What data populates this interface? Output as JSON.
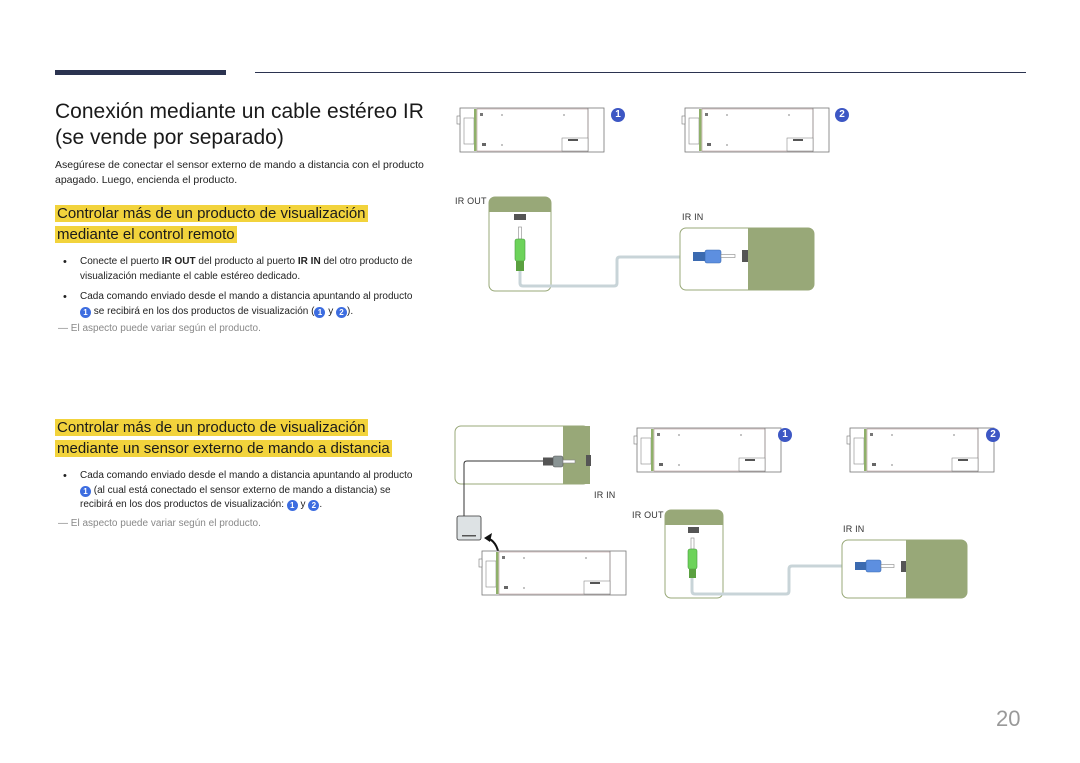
{
  "page": {
    "title": "Conexión mediante un cable estéreo IR (se vende por separado)",
    "intro": "Asegúrese de conectar el sensor externo de mando a distancia con el producto apagado. Luego, encienda el producto.",
    "page_number": "20"
  },
  "section_remote": {
    "heading_line1": "Controlar más de un producto de visualización",
    "heading_line2": "mediante el control remoto",
    "bullet1": {
      "t1": "Conecte el puerto ",
      "ir_out": "IR OUT",
      "t2": " del producto al puerto ",
      "ir_in": "IR IN",
      "t3": " del otro producto de visualización mediante el cable estéreo dedicado."
    },
    "bullet2": {
      "t1": "Cada comando enviado desde el mando a distancia apuntando al producto ",
      "badge1": "1",
      "t2": " se recibirá en los dos productos de visualización (",
      "badge2": "1",
      "t3": " y ",
      "badge3": "2",
      "t4": ")."
    },
    "note": "― El aspecto puede variar según el producto.",
    "diagram": {
      "label_ir_out": "IR OUT",
      "label_ir_in": "IR IN",
      "badge_left": "1",
      "badge_right": "2"
    }
  },
  "section_sensor": {
    "heading_line1": "Controlar más de un producto de visualización",
    "heading_line2": "mediante un sensor externo de mando a distancia",
    "bullet1": {
      "t1": "Cada comando enviado desde el mando a distancia apuntando al producto ",
      "badge1": "1",
      "t2": " (al cual está conectado el sensor externo de mando a distancia) se recibirá en los dos productos de visualización: ",
      "badge2": "1",
      "t3": " y ",
      "badge3": "2",
      "t4": "."
    },
    "note": "― El aspecto puede variar según el producto.",
    "diagram": {
      "label_sensor_ir_in": "IR IN",
      "label_ir_out": "IR OUT",
      "label_ir_in": "IR IN",
      "badge_left": "1",
      "badge_right": "2"
    }
  },
  "colors": {
    "accent_bar": "#2b3350",
    "highlight": "#f2d33c",
    "badge_blue": "#3d57c4",
    "panel_green": "#98a878",
    "jack_green": "#6dd35a",
    "jack_blue": "#5d8fe0"
  }
}
